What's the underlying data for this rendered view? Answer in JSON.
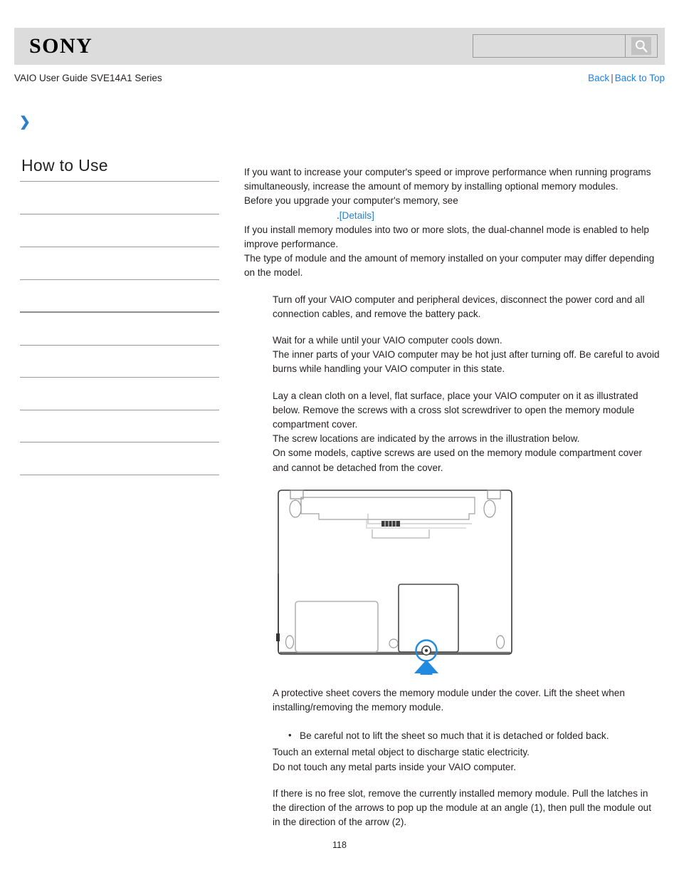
{
  "header": {
    "brand": "SONY",
    "search": {
      "value": "",
      "placeholder": "",
      "icon": "search-icon",
      "button_label": ""
    }
  },
  "sub_header": {
    "guide_title": "VAIO User Guide SVE14A1 Series",
    "nav": {
      "back": "Back",
      "separator": "|",
      "back_to_top": "Back to Top"
    }
  },
  "marker": {
    "chevron": "❯"
  },
  "sidebar": {
    "title": "How to Use",
    "items": [
      {
        "label": ""
      },
      {
        "label": ""
      },
      {
        "label": ""
      },
      {
        "label": ""
      },
      {
        "label": ""
      },
      {
        "label": ""
      },
      {
        "label": ""
      },
      {
        "label": ""
      },
      {
        "label": ""
      },
      {
        "label": ""
      }
    ]
  },
  "content": {
    "intro": {
      "p1": "If you want to increase your computer's speed or improve performance when running programs simultaneously, increase the amount of memory by installing optional memory modules.",
      "p2": "Before you upgrade your computer's memory, see",
      "details_prefix": ".",
      "details_link": "[Details]",
      "p3": "If you install memory modules into two or more slots, the dual-channel mode is enabled to help improve performance.",
      "p4": "The type of module and the amount of memory installed on your computer may differ depending on the model."
    },
    "steps": [
      "Turn off your VAIO computer and peripheral devices, disconnect the power cord and all connection cables, and remove the battery pack.",
      "Wait for a while until your VAIO computer cools down.\nThe inner parts of your VAIO computer may be hot just after turning off. Be careful to avoid burns while handling your VAIO computer in this state.",
      "Lay a clean cloth on a level, flat surface, place your VAIO computer on it as illustrated below. Remove the screws with a cross slot screwdriver to open the memory module compartment cover.\nThe screw locations are indicated by the arrows in the illustration below.\nOn some models, captive screws are used on the memory module compartment cover and cannot be detached from the cover."
    ],
    "illustration": {
      "alt": "Bottom view of VAIO laptop showing memory module compartment cover screw location indicated by a blue arrow",
      "arrow_color": "#1f8ae0",
      "highlight_color": "#1f8ae0"
    },
    "after_illustration": {
      "p5": "A protective sheet covers the memory module under the cover. Lift the sheet when installing/removing the memory module.",
      "note_bullet": "Be careful not to lift the sheet so much that it is detached or folded back.",
      "p6": "Touch an external metal object to discharge static electricity.\nDo not touch any metal parts inside your VAIO computer.",
      "p7": "If there is no free slot, remove the currently installed memory module. Pull the latches in the direction of the arrows to pop up the module at an angle (1), then pull the module out in the direction of the arrow (2)."
    }
  },
  "footer": {
    "page_number": "118"
  },
  "colors": {
    "link": "#1f7fdc",
    "accent": "#2a7fc9",
    "header_band": "#dcdcdc",
    "rule": "#9a9a9a",
    "text": "#231f20"
  }
}
